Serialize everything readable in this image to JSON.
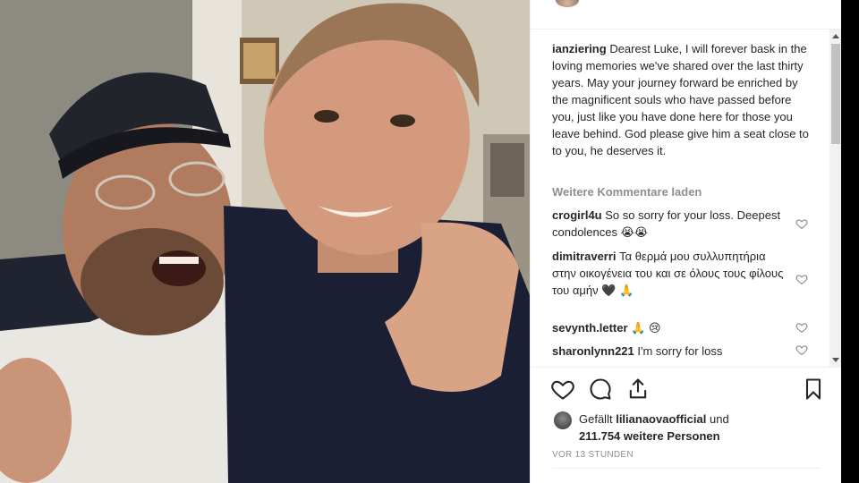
{
  "caption": {
    "username": "ianziering",
    "text": "Dearest Luke, I will forever bask in the loving memories we've shared over the last thirty years. May your journey forward be enriched by the magnificent souls who have passed before you, just like you have done here for those you leave behind. God please give him a seat close to to you, he deserves it."
  },
  "load_more_label": "Weitere Kommentare laden",
  "comments": [
    {
      "username": "crogirl4u",
      "text": "So so sorry for your loss. Deepest condolences",
      "emoji": "😭😭"
    },
    {
      "username": "dimitraverri",
      "text": "Τα θερμά μου συλλυπητήρια στην οικογένεια του και σε όλους τους φίλους του αμήν",
      "emoji": "🖤 🙏"
    },
    {
      "username": "sevynth.letter",
      "text": "",
      "emoji": "🙏 😢"
    },
    {
      "username": "sharonlynn221",
      "text": "I'm sorry for loss",
      "emoji": ""
    }
  ],
  "actions": {
    "like_icon": "heart-outline-icon",
    "comment_icon": "speech-bubble-icon",
    "share_icon": "share-upload-icon",
    "save_icon": "bookmark-icon"
  },
  "likes": {
    "prefix": "Gefällt",
    "user": "lilianaovaofficial",
    "and": "und",
    "count": "211.754",
    "suffix": "weitere Personen"
  },
  "timestamp": "VOR 13 STUNDEN",
  "colors": {
    "text": "#262626",
    "muted": "#8e8e8e",
    "divider": "#efefef"
  }
}
